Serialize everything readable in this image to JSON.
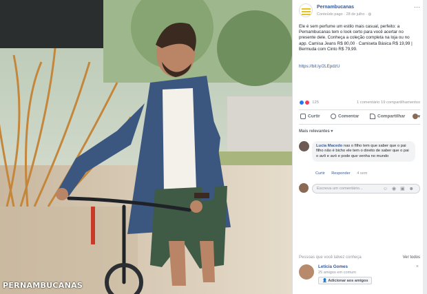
{
  "watermark": "PERNAMBUCANAS",
  "post": {
    "page_name": "Pernambucanas",
    "meta": "Conteúdo pago · 28 de julho · ",
    "more": "···",
    "text": "Ele é sem perfume um estilo mais casual, perfeito: a Pernambucanas tem o look certo para você acertar no presente dele. Conheça a coleção completa na loja ou no app. Camisa Jeans R$ 80,00 · Camiseta Básica R$ 19,99 | Bermuda com Cinto R$ 79,99.",
    "link": "https://bit.ly/2LEpdzU"
  },
  "reactions": {
    "count": "125",
    "stats": "1 comentário  19 compartilhamentos"
  },
  "actions": {
    "like": "Curtir",
    "comment": "Comentar",
    "share": "Compartilhar",
    "caret": "▾"
  },
  "comments": {
    "sort_label": "Mais relevantes ▾",
    "items": [
      {
        "author": "Lucia Macedo",
        "text": "nas o filho tem que saber que o pai filho não é bicho ele tem o direito de saber que o pai o avô e avó e pode que venha no mundo",
        "like": "Curtir",
        "reply": "Responder",
        "time": "4 sem"
      }
    ],
    "compose_placeholder": "Escreva um comentário...",
    "compose_icons": "☺ ◉ ▣ ☻"
  },
  "suggestions": {
    "title": "Pessoas que você talvez conheça",
    "see_all": "Ver todos",
    "people": [
      {
        "name": "Leticia Gomes",
        "mutual": "25 amigos em comum",
        "add": "Adicionar aos amigos",
        "close": "×"
      }
    ]
  },
  "colors": {
    "brand_blue": "#365899",
    "like_blue": "#2078f4",
    "love_red": "#f33e58",
    "logo_yellow": "#e6c21d"
  }
}
